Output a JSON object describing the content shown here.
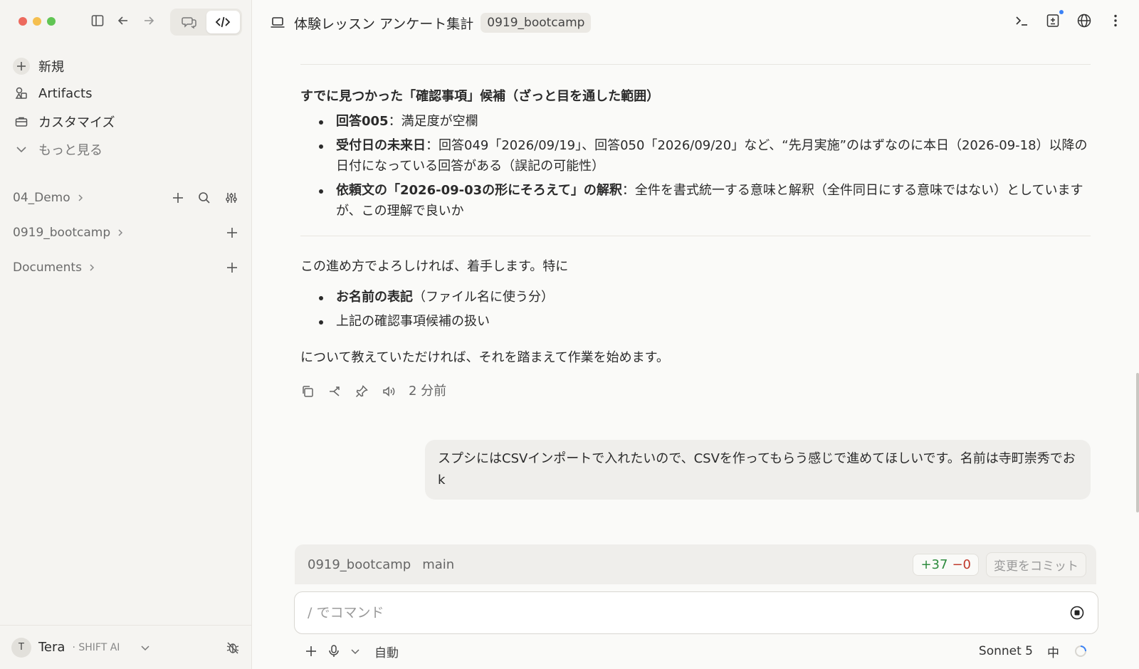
{
  "sidebar": {
    "nav": {
      "new_label": "新規",
      "artifacts_label": "Artifacts",
      "customize_label": "カスタマイズ",
      "more_label": "もっと見る"
    },
    "projects": [
      {
        "name": "04_Demo"
      },
      {
        "name": "0919_bootcamp"
      },
      {
        "name": "Documents"
      }
    ],
    "user": {
      "initial": "T",
      "name": "Tera",
      "org": "· SHIFT AI"
    }
  },
  "header": {
    "title": "体験レッスン アンケート集計",
    "badge": "0919_bootcamp"
  },
  "content": {
    "section_title": "すでに見つかった「確認事項」候補（ざっと目を通した範囲）",
    "items": [
      {
        "bold": "回答005",
        "text": "：満足度が空欄"
      },
      {
        "bold": "受付日の未来日",
        "text": "：回答049「2026/09/19」、回答050「2026/09/20」など、“先月実施”のはずなのに本日（2026-09-18）以降の日付になっている回答がある（誤記の可能性）"
      },
      {
        "bold": "依頼文の「2026-09-03の形にそろえて」の解釈",
        "text": "：全件を書式統一する意味と解釈（全件同日にする意味ではない）としていますが、この理解で良いか"
      }
    ],
    "para1": "この進め方でよろしければ、着手します。特に",
    "items2": [
      {
        "bold": "お名前の表記",
        "text": "（ファイル名に使う分）"
      },
      {
        "bold": "",
        "text": "上記の確認事項候補の扱い"
      }
    ],
    "para2": "について教えていただければ、それを踏まえて作業を始めます。",
    "timestamp": "2 分前"
  },
  "user_message": "スプシにはCSVインポートで入れたいので、CSVを作ってもらう感じで進めてほしいです。名前は寺町崇秀でおk",
  "gitbar": {
    "repo": "0919_bootcamp",
    "branch": "main",
    "additions": "+37",
    "deletions": "−0",
    "commit_label": "変更をコミット"
  },
  "composer": {
    "placeholder": "/ でコマンド",
    "mode_label": "自動",
    "model_label": "Sonnet 5",
    "effort_label": "中"
  }
}
